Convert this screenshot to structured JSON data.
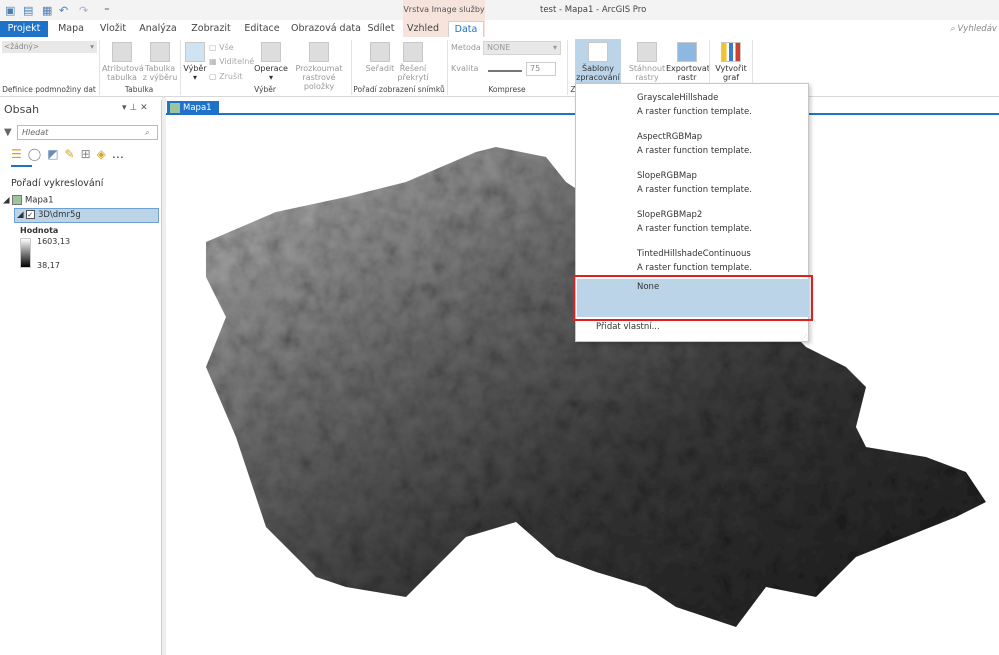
{
  "window": {
    "title": "test - Mapa1 - ArcGIS Pro",
    "context_tab_group": "Vrstva Image služby",
    "search_placeholder": "Vyhledáv"
  },
  "tabs": [
    "Projekt",
    "Mapa",
    "Vložit",
    "Analýza",
    "Zobrazit",
    "Editace",
    "Obrazová data",
    "Sdílet",
    "Vzhled",
    "Data"
  ],
  "ribbon": {
    "definition": {
      "value": "<žádný>",
      "group": "Definice podmnožiny dat"
    },
    "table": {
      "buttons": [
        "Atributová tabulka",
        "Tabulka z výběru"
      ],
      "group": "Tabulka"
    },
    "selection": {
      "select": "Výběr",
      "all": "Vše",
      "visible": "Viditelné",
      "clear": "Zrušit",
      "operations": "Operace",
      "explore": "Prozkoumat rastrové položky",
      "group": "Výběr"
    },
    "order": {
      "sort": "Seřadit",
      "overlap": "Řešení překrytí",
      "group": "Pořadí zobrazení snímků"
    },
    "compression": {
      "method_label": "Metoda",
      "method_value": "NONE",
      "quality_label": "Kvalita",
      "quality_value": "75",
      "group": "Komprese"
    },
    "processing": {
      "templates": "Šablony zpracování",
      "group_initial": "Z"
    },
    "download": "Stáhnout rastry",
    "export": "Exportovat rastr",
    "chart": "Vytvořit graf"
  },
  "contents": {
    "title": "Obsah",
    "search_placeholder": "Hledat",
    "section": "Pořadí vykreslování",
    "map": "Mapa1",
    "layer": "3D\\dmr5g",
    "legend_title": "Hodnota",
    "max": "1603,13",
    "min": "38,17"
  },
  "map_tab": "Mapa1",
  "dropdown": {
    "items": [
      {
        "name": "GrayscaleHillshade",
        "desc": "A raster function template."
      },
      {
        "name": "AspectRGBMap",
        "desc": "A raster function template."
      },
      {
        "name": "SlopeRGBMap",
        "desc": "A raster function template."
      },
      {
        "name": "SlopeRGBMap2",
        "desc": "A raster function template."
      },
      {
        "name": "TintedHillshadeContinuous",
        "desc": "A raster function template."
      }
    ],
    "selected": "None",
    "add_custom": "Přidat vlastní..."
  },
  "colors": {
    "accent": "#1e73c8",
    "highlight": "#bcd4e8",
    "red_box": "#e02020"
  }
}
